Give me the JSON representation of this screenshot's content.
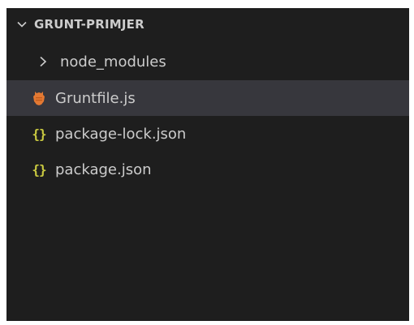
{
  "explorer": {
    "folder": {
      "name": "GRUNT-PRIMJER",
      "expanded": true,
      "chevron_icon": "chevron-down-icon"
    },
    "items": [
      {
        "label": "node_modules",
        "icon": "chevron-right-icon",
        "type": "folder",
        "expanded": false
      },
      {
        "label": "Gruntfile.js",
        "icon": "grunt-file-icon",
        "type": "file",
        "selected": true
      },
      {
        "label": "package-lock.json",
        "icon": "json-braces-icon",
        "type": "file"
      },
      {
        "label": "package.json",
        "icon": "json-braces-icon",
        "type": "file"
      }
    ],
    "colors": {
      "background": "#1e1e1e",
      "text": "#cccccc",
      "selected_row": "#37373d",
      "json_icon": "#cbcb41",
      "grunt_icon": "#e37933"
    }
  }
}
